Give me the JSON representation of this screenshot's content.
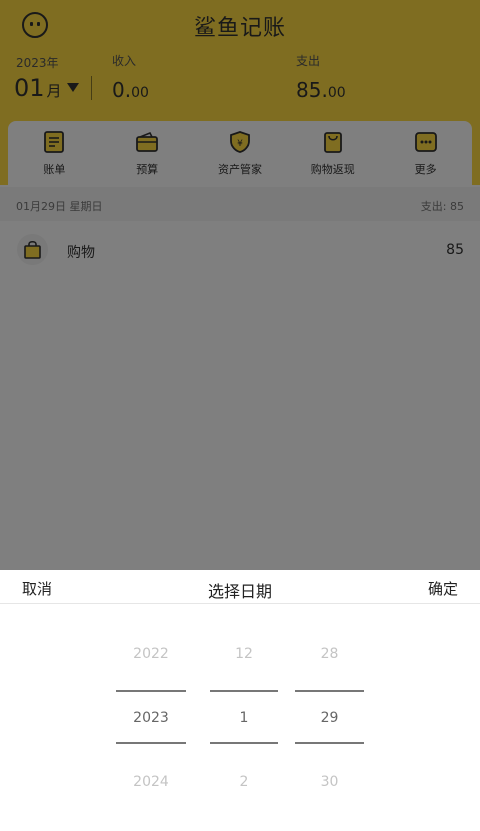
{
  "header": {
    "app_title": "鲨鱼记账",
    "year": "2023年",
    "month_number": "01",
    "month_unit": "月",
    "income_label": "收入",
    "income_int": "0.",
    "income_dec": "00",
    "expense_label": "支出",
    "expense_int": "85.",
    "expense_dec": "00"
  },
  "quick_nav": {
    "items": [
      {
        "label": "账单",
        "icon": "bill-icon"
      },
      {
        "label": "预算",
        "icon": "budget-wallet-icon"
      },
      {
        "label": "资产管家",
        "icon": "asset-shield-icon"
      },
      {
        "label": "购物返现",
        "icon": "shopping-cashback-icon"
      },
      {
        "label": "更多",
        "icon": "more-icon"
      }
    ]
  },
  "day_group": {
    "date": "01月29日 星期日",
    "summary": "支出: 85"
  },
  "records": [
    {
      "category": "购物",
      "amount": "85",
      "icon": "shopping-bag-icon"
    }
  ],
  "picker": {
    "cancel_label": "取消",
    "title": "选择日期",
    "confirm_label": "确定",
    "years": [
      "2022",
      "2023",
      "2024"
    ],
    "months": [
      "12",
      "1",
      "2"
    ],
    "days": [
      "28",
      "29",
      "30"
    ],
    "selected": {
      "year": "2023",
      "month": "1",
      "day": "29"
    }
  },
  "colors": {
    "brand_yellow": "#fedb43",
    "overlay": "rgba(0,0,0,0.5)"
  }
}
